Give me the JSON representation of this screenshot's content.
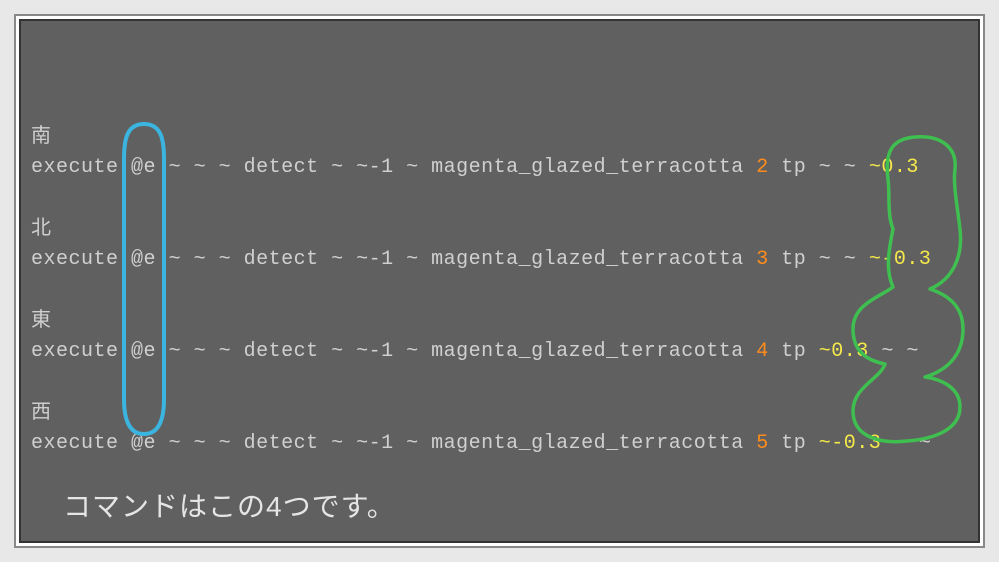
{
  "commands": [
    {
      "direction": "南",
      "exec": "execute",
      "selector": "@e",
      "tildes1": "~ ~ ~",
      "detect": "detect",
      "tildes2": "~ ~-1 ~",
      "block": "magenta_glazed_terracotta",
      "id": "2",
      "tp": "tp",
      "tp_args_pre": "~ ~ ",
      "tp_args_full": "~0.3",
      "tp_args_post": ""
    },
    {
      "direction": "北",
      "exec": "execute",
      "selector": "@e",
      "tildes1": "~ ~ ~",
      "detect": "detect",
      "tildes2": "~ ~-1 ~",
      "block": "magenta_glazed_terracotta",
      "id": "3",
      "tp": "tp",
      "tp_args_pre": "~ ~ ",
      "tp_args_full": "~-0.3",
      "tp_args_post": ""
    },
    {
      "direction": "東",
      "exec": "execute",
      "selector": "@e",
      "tildes1": "~ ~ ~",
      "detect": "detect",
      "tildes2": "~ ~-1 ~",
      "block": "magenta_glazed_terracotta",
      "id": "4",
      "tp": "tp",
      "tp_args_pre": "",
      "tp_args_full": "~0.3",
      "tp_args_post": " ~ ~"
    },
    {
      "direction": "西",
      "exec": "execute",
      "selector": "@e",
      "tildes1": "~ ~ ~",
      "detect": "detect",
      "tildes2": "~ ~-1 ~",
      "block": "magenta_glazed_terracotta",
      "id": "5",
      "tp": "tp",
      "tp_args_pre": "",
      "tp_args_full": "~-0.3",
      "tp_args_post": " ~ ~"
    }
  ],
  "caption": "コマンドはこの4つです。",
  "annotations": {
    "blue_stroke": "#3bb5e0",
    "green_stroke": "#3fbf4f"
  }
}
